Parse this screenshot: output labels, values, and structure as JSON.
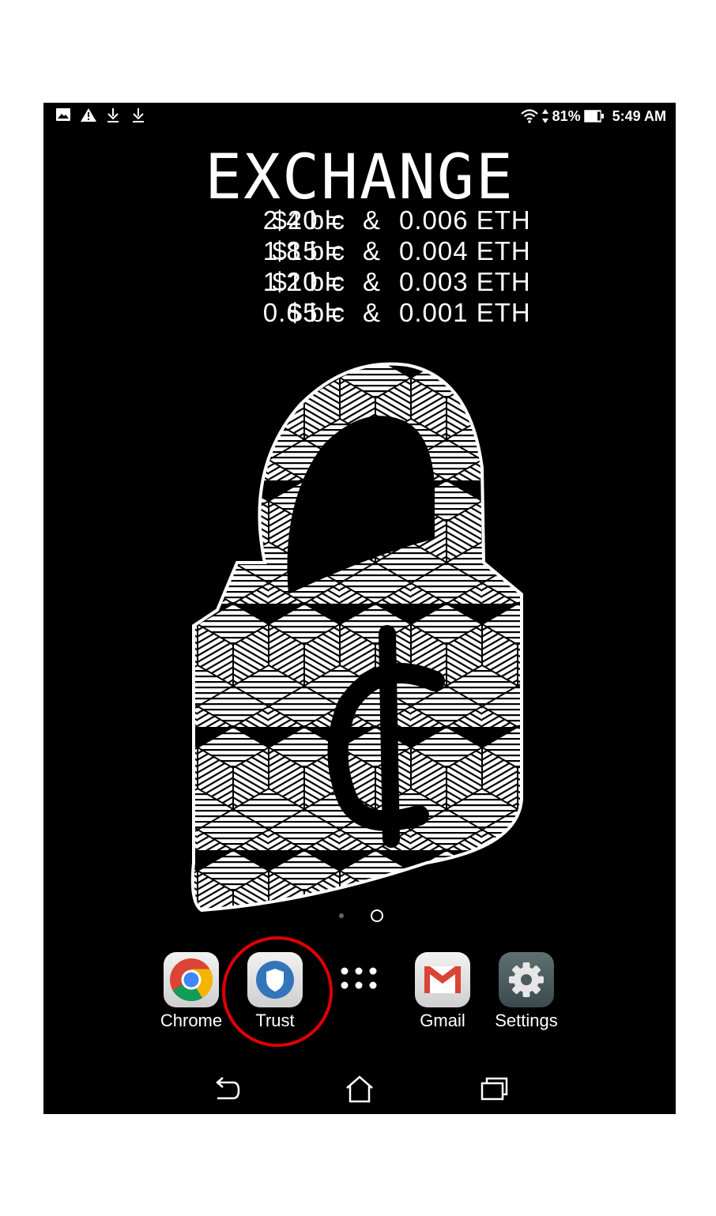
{
  "status_bar": {
    "left_icons": [
      "image-icon",
      "warning-icon",
      "download-icon",
      "download-icon"
    ],
    "right_icons": [
      "wifi-icon",
      "data-arrows-icon",
      "battery-icon"
    ],
    "battery": "81%",
    "time": "5:49 AM"
  },
  "wallpaper": {
    "title": "EXCHANGE",
    "rates": [
      {
        "usd": "$20",
        "eq": "=",
        "blc": "2.4 blc",
        "amp": "&",
        "eth": "0.006 ETH"
      },
      {
        "usd": "$15",
        "eq": "=",
        "blc": "1.8 blc",
        "amp": "&",
        "eth": "0.004 ETH"
      },
      {
        "usd": "$10",
        "eq": "=",
        "blc": "1.2 blc",
        "amp": "&",
        "eth": "0.003 ETH"
      },
      {
        "usd": "$5",
        "eq": "=",
        "blc": "0.6 blc",
        "amp": "&",
        "eth": "0.001 ETH"
      }
    ],
    "lock_glyph": "¢"
  },
  "page_indicator": {
    "pages": 2,
    "current": 2
  },
  "dock": {
    "apps": [
      {
        "label": "Chrome",
        "icon": "chrome-icon"
      },
      {
        "label": "Trust",
        "icon": "trust-shield-icon"
      },
      {
        "label": "",
        "icon": "app-drawer-icon"
      },
      {
        "label": "Gmail",
        "icon": "gmail-icon"
      },
      {
        "label": "Settings",
        "icon": "settings-gear-icon"
      }
    ],
    "highlight": {
      "app": "Trust",
      "color": "#e00000"
    }
  },
  "nav_bar": {
    "buttons": [
      "back-icon",
      "home-icon",
      "recents-icon"
    ]
  }
}
